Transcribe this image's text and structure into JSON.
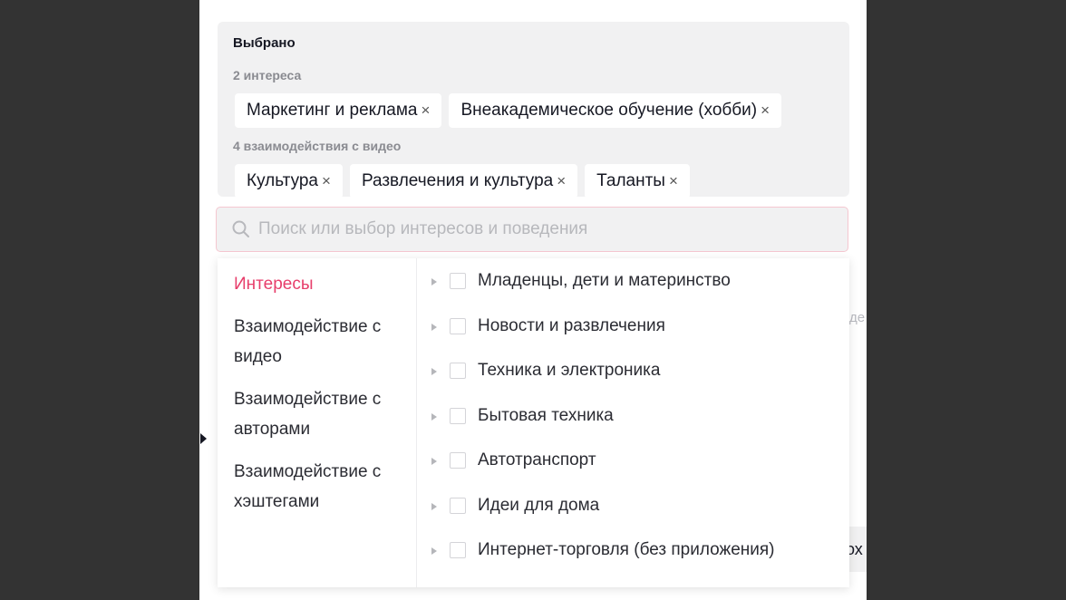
{
  "selected": {
    "title": "Выбрано",
    "interests_label": "2 интереса",
    "interests": [
      "Маркетинг и реклама",
      "Внеакадемическое обучение (хобби)"
    ],
    "video_label": "4 взаимодействия с видео",
    "video": [
      "Культура",
      "Развлечения и культура",
      "Таланты"
    ]
  },
  "chip_remove_glyph": "×",
  "search": {
    "placeholder": "Поиск или выбор интересов и поведения",
    "icon": "search-icon"
  },
  "categories": {
    "interests": "Интересы",
    "video": "Взаимодействие с видео",
    "creators": "Взаимодействие с авторами",
    "hashtags": "Взаимодействие с хэштегами",
    "active_color": "#e73e6b"
  },
  "options": [
    "Младенцы, дети и материнство",
    "Новости и развлечения",
    "Техника и электроника",
    "Бытовая техника",
    "Автотранспорт",
    "Идеи для дома",
    "Интернет-торговля (без приложения)"
  ],
  "background": {
    "fragment_right": "де",
    "fragment_bottom": "ох"
  }
}
